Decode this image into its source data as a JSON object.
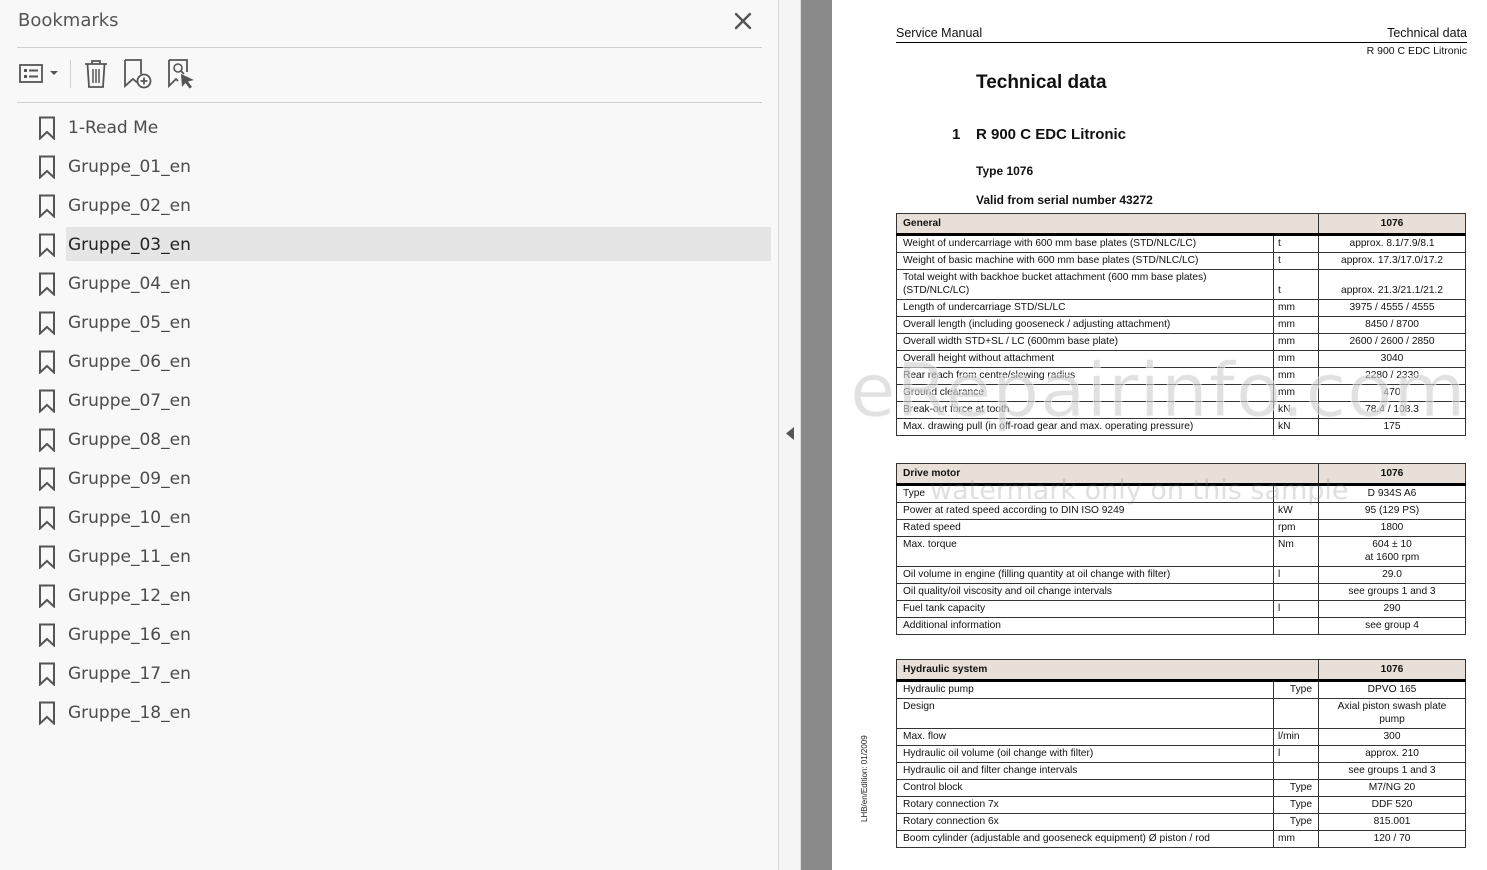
{
  "bookmarks_panel": {
    "title": "Bookmarks",
    "toolbar": {
      "options_icon": "list-options-icon",
      "delete_icon": "trash-icon",
      "new_bookmark_icon": "new-bookmark-icon",
      "find_bookmark_icon": "find-bookmark-icon"
    },
    "items": [
      {
        "label": "1-Read Me"
      },
      {
        "label": "Gruppe_01_en"
      },
      {
        "label": "Gruppe_02_en"
      },
      {
        "label": "Gruppe_03_en",
        "selected": true
      },
      {
        "label": "Gruppe_04_en"
      },
      {
        "label": "Gruppe_05_en"
      },
      {
        "label": "Gruppe_06_en"
      },
      {
        "label": "Gruppe_07_en"
      },
      {
        "label": "Gruppe_08_en"
      },
      {
        "label": "Gruppe_09_en"
      },
      {
        "label": "Gruppe_10_en"
      },
      {
        "label": "Gruppe_11_en"
      },
      {
        "label": "Gruppe_12_en"
      },
      {
        "label": "Gruppe_16_en"
      },
      {
        "label": "Gruppe_17_en"
      },
      {
        "label": "Gruppe_18_en"
      }
    ]
  },
  "document": {
    "header_left": "Service Manual",
    "header_right": "Technical data",
    "header_sub": "R 900 C EDC Litronic",
    "title": "Technical data",
    "section_number": "1",
    "section_title": "R 900 C EDC Litronic",
    "type_label": "Type 1076",
    "valid_label": "Valid from serial number 43272",
    "edition": "LHB/en/Edition: 01/2009",
    "watermark": "eRepairinfo.com",
    "watermark_note": "watermark only on this sample",
    "tables": {
      "general": {
        "header": "General",
        "col": "1076",
        "rows": [
          {
            "label": "Weight of undercarriage with 600 mm base plates (STD/NLC/LC)",
            "unit": "t",
            "value": "approx. 8.1/7.9/8.1"
          },
          {
            "label": "Weight of basic machine with 600 mm base plates (STD/NLC/LC)",
            "unit": "t",
            "value": "approx. 17.3/17.0/17.2"
          },
          {
            "label": "Total weight with backhoe bucket attachment (600 mm base plates) (STD/NLC/LC)",
            "unit": "t",
            "value": "approx. 21.3/21.1/21.2"
          },
          {
            "label": "Length of undercarriage STD/SL/LC",
            "unit": "mm",
            "value": "3975 / 4555 / 4555"
          },
          {
            "label": "Overall length (including gooseneck / adjusting attachment)",
            "unit": "mm",
            "value": "8450 / 8700"
          },
          {
            "label": "Overall width STD+SL / LC (600mm base plate)",
            "unit": "mm",
            "value": "2600 / 2600 / 2850"
          },
          {
            "label": "Overall height without attachment",
            "unit": "mm",
            "value": "3040"
          },
          {
            "label": "Rear reach from centre/slewing radius",
            "unit": "mm",
            "value": "2280 / 2330"
          },
          {
            "label": "Ground clearance",
            "unit": "mm",
            "value": "470"
          },
          {
            "label": "Break-out force at tooth",
            "unit": "kN",
            "value": "78.4 / 108.3"
          },
          {
            "label": "Max. drawing pull (in off-road gear and max. operating pressure)",
            "unit": "kN",
            "value": "175"
          }
        ]
      },
      "drive_motor": {
        "header": "Drive motor",
        "col": "1076",
        "rows": [
          {
            "label": "Type",
            "unit": "",
            "value": "D 934S A6"
          },
          {
            "label": "Power at rated speed according to DIN ISO 9249",
            "unit": "kW",
            "value": "95 (129 PS)"
          },
          {
            "label": "Rated speed",
            "unit": "rpm",
            "value": "1800"
          },
          {
            "label": "Max. torque",
            "unit": "Nm",
            "value": "604 ± 10",
            "value2": "at 1600 rpm"
          },
          {
            "label": "Oil volume in engine (filling quantity at oil change with filter)",
            "unit": "l",
            "value": "29.0"
          },
          {
            "label": "Oil quality/oil viscosity and oil change intervals",
            "unit": "",
            "value": "see groups 1 and 3"
          },
          {
            "label": "Fuel tank capacity",
            "unit": "l",
            "value": "290"
          },
          {
            "label": "Additional information",
            "unit": "",
            "value": "see group 4"
          }
        ]
      },
      "hydraulic": {
        "header": "Hydraulic system",
        "col": "1076",
        "rows": [
          {
            "label": "Hydraulic pump",
            "unit": "Type",
            "value": "DPVO 165"
          },
          {
            "label": "Design",
            "unit": "",
            "value": "Axial piston swash plate",
            "value2": "pump"
          },
          {
            "label": "Max. flow",
            "unit": "l/min",
            "value": "300"
          },
          {
            "label": "Hydraulic oil volume (oil change with filter)",
            "unit": "l",
            "value": "approx. 210"
          },
          {
            "label": "Hydraulic oil and filter change intervals",
            "unit": "",
            "value": "see groups 1 and 3"
          },
          {
            "label": "Control block",
            "unit": "Type",
            "value": "M7/NG 20"
          },
          {
            "label": "Rotary connection 7x",
            "unit": "Type",
            "value": "DDF 520"
          },
          {
            "label": "Rotary connection 6x",
            "unit": "Type",
            "value": "815.001"
          },
          {
            "label": "Boom cylinder (adjustable and gooseneck equipment) Ø piston / rod",
            "unit": "mm",
            "value": "120 / 70"
          }
        ]
      }
    }
  }
}
